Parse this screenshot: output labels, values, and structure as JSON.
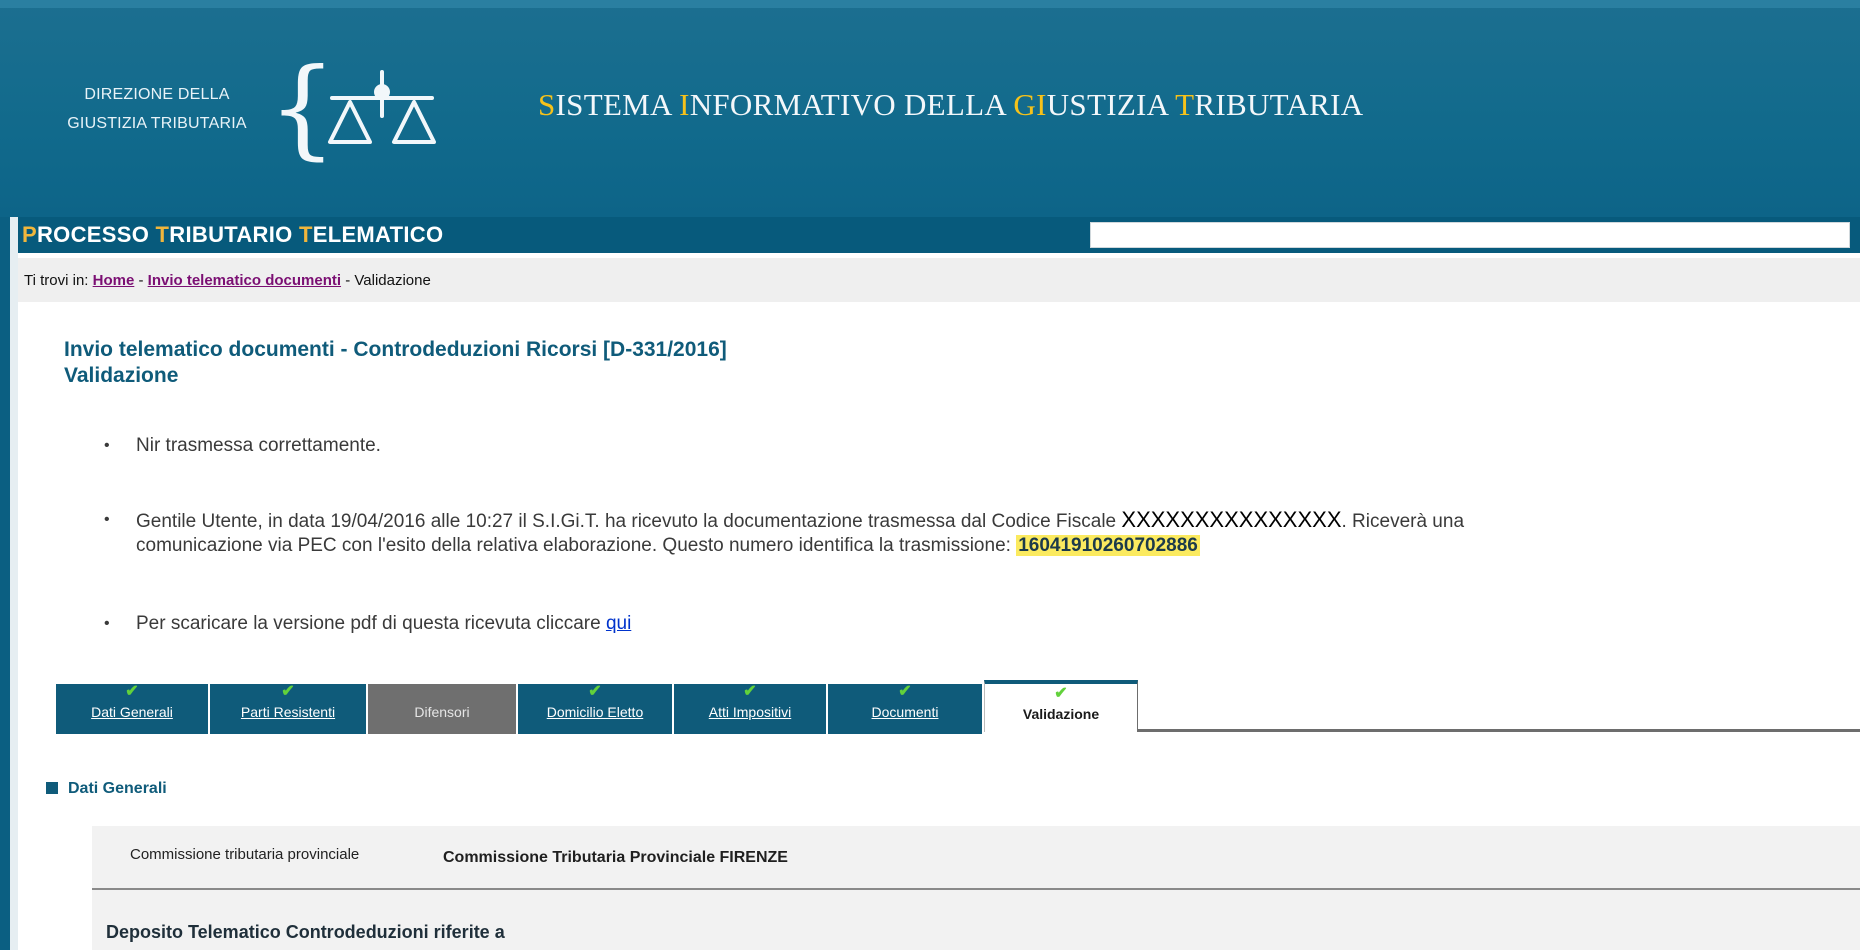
{
  "header": {
    "org_line1": "DIREZIONE DELLA",
    "org_line2": "GIUSTIZIA TRIBUTARIA",
    "system_title": [
      {
        "initial": "S",
        "rest": "ISTEMA "
      },
      {
        "initial": "I",
        "rest": "NFORMATIVO DELLA "
      },
      {
        "initial": "GI",
        "rest": "USTIZIA "
      },
      {
        "initial": "T",
        "rest": "RIBUTARIA"
      }
    ],
    "ptt_title": [
      {
        "initial": "P",
        "rest": "ROCESSO "
      },
      {
        "initial": "T",
        "rest": "RIBUTARIO "
      },
      {
        "initial": "T",
        "rest": "ELEMATICO"
      }
    ],
    "logo_icon": "scales-of-justice-icon"
  },
  "breadcrumb": {
    "prefix": "Ti trovi in: ",
    "home": "Home",
    "sep1": " - ",
    "section": "Invio telematico documenti",
    "sep2": " - ",
    "current": "Validazione"
  },
  "page": {
    "title": "Invio telematico documenti - Controdeduzioni Ricorsi [D-331/2016]",
    "subtitle": "Validazione"
  },
  "messages": {
    "bullet": "•",
    "msg1": "Nir trasmessa correttamente.",
    "msg2_part1": "Gentile Utente, in data 19/04/2016 alle 10:27 il S.I.Gi.T. ha ricevuto la documentazione trasmessa dal Codice Fiscale ",
    "codice_fiscale": "XXXXXXXXXXXXXXX",
    "msg2_part2": ". Riceverà una",
    "msg2_line2": "comunicazione via PEC con l'esito della relativa elaborazione. Questo numero identifica la trasmissione: ",
    "transmission_id": "16041910260702886",
    "msg3_text": "Per scaricare la versione pdf di questa ricevuta cliccare ",
    "msg3_link": "qui"
  },
  "tabs": [
    {
      "label": "Dati Generali",
      "check": "✔",
      "state": "done"
    },
    {
      "label": "Parti Resistenti",
      "check": "✔",
      "state": "done"
    },
    {
      "label": "Difensori",
      "check": "",
      "state": "disabled"
    },
    {
      "label": "Domicilio Eletto",
      "check": "✔",
      "state": "done"
    },
    {
      "label": "Atti Impositivi",
      "check": "✔",
      "state": "done"
    },
    {
      "label": "Documenti",
      "check": "✔",
      "state": "done"
    },
    {
      "label": "Validazione",
      "check": "✔",
      "state": "active"
    }
  ],
  "section": {
    "title": "Dati Generali",
    "commissione_label": "Commissione tributaria provinciale",
    "commissione_value": "Commissione Tributaria Provinciale FIRENZE",
    "deposito_title": "Deposito Telematico Controdeduzioni riferite a"
  },
  "colors": {
    "header_blue": "#116a8c",
    "accent_yellow": "#f6c21a",
    "tab_blue": "#0f5b7a",
    "tab_disabled": "#6f6f6f",
    "check_green": "#62d13b",
    "highlight": "#fbea5f"
  }
}
